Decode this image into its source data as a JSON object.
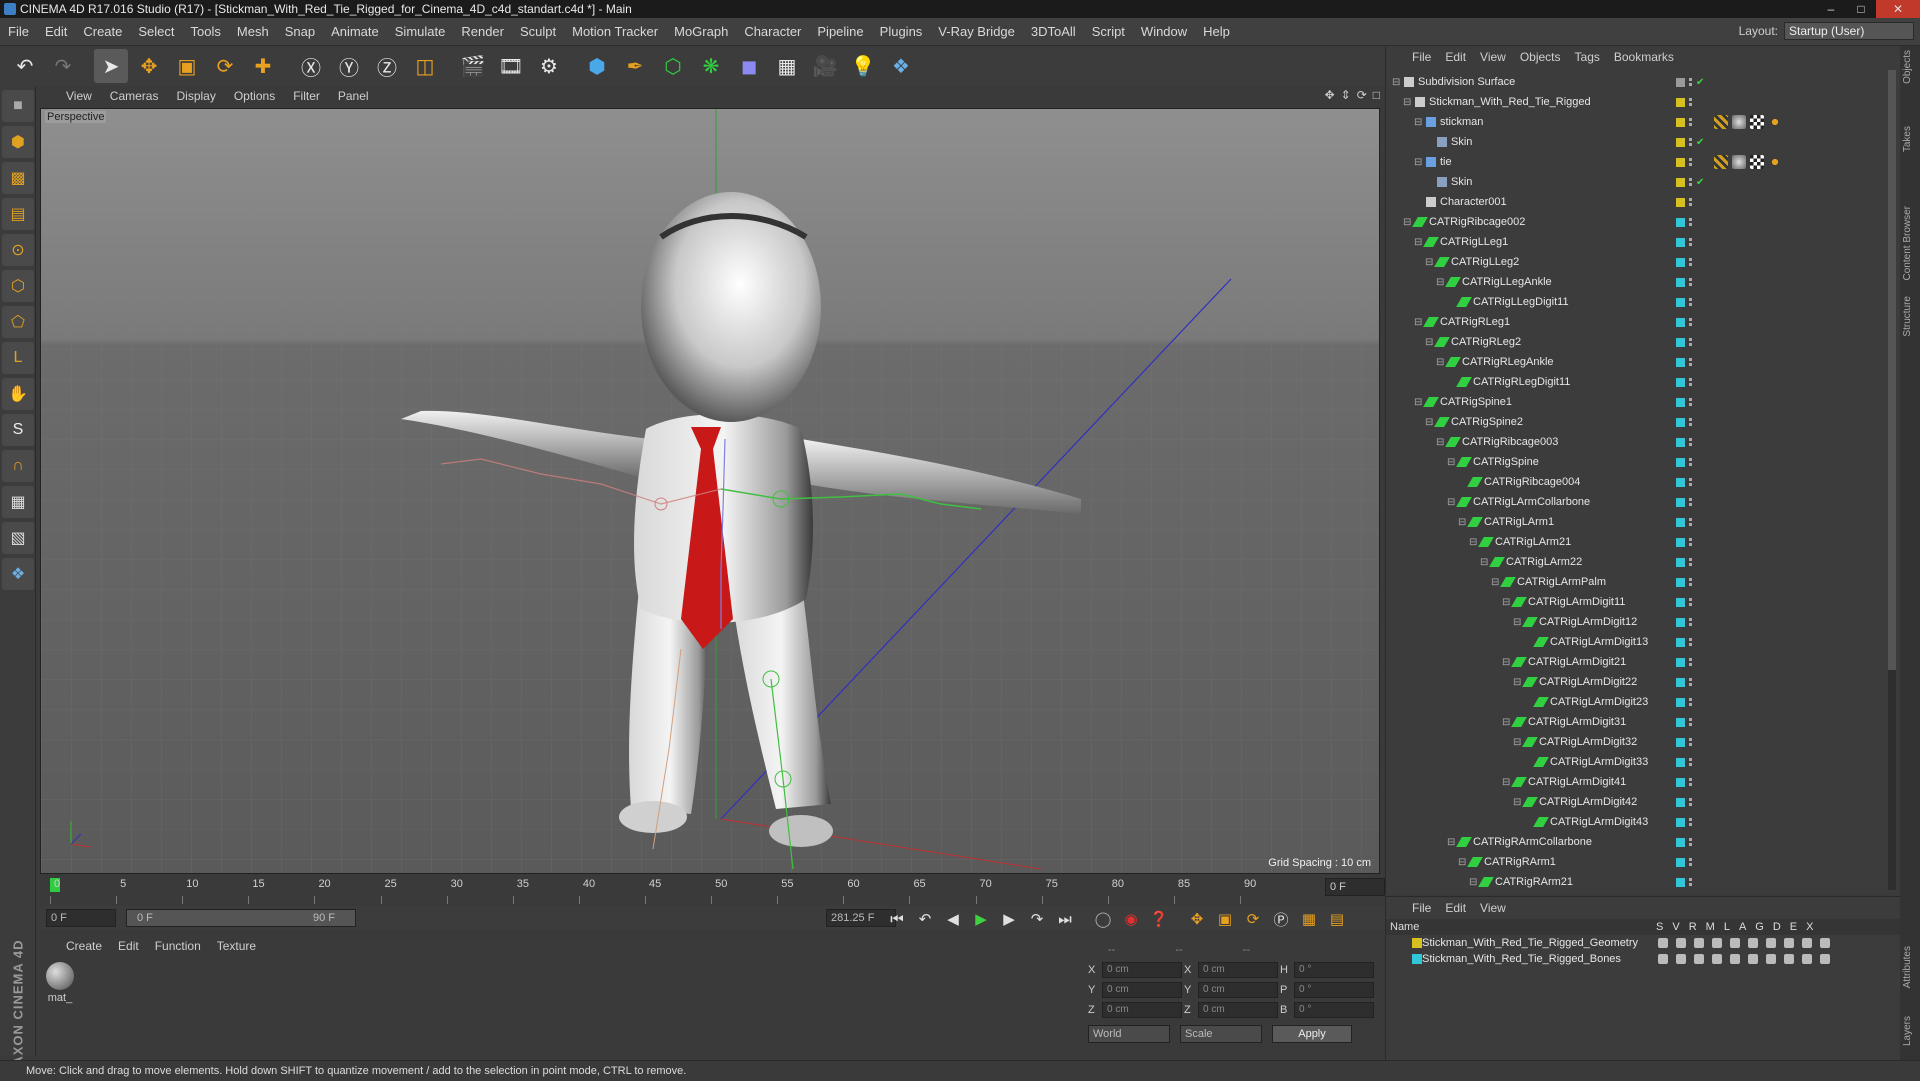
{
  "titlebar": {
    "title": "CINEMA 4D R17.016 Studio (R17) - [Stickman_With_Red_Tie_Rigged_for_Cinema_4D_c4d_standart.c4d *] - Main"
  },
  "menubar": {
    "items": [
      "File",
      "Edit",
      "Create",
      "Select",
      "Tools",
      "Mesh",
      "Snap",
      "Animate",
      "Simulate",
      "Render",
      "Sculpt",
      "Motion Tracker",
      "MoGraph",
      "Character",
      "Pipeline",
      "Plugins",
      "V-Ray Bridge",
      "3DToAll",
      "Script",
      "Window",
      "Help"
    ]
  },
  "layout": {
    "label": "Layout:",
    "value": "Startup (User)"
  },
  "viewport": {
    "menu": [
      "View",
      "Cameras",
      "Display",
      "Options",
      "Filter",
      "Panel"
    ],
    "label": "Perspective",
    "grid_spacing": "Grid Spacing : 10 cm"
  },
  "timeline": {
    "ticks": [
      "0",
      "5",
      "10",
      "15",
      "20",
      "25",
      "30",
      "35",
      "40",
      "45",
      "50",
      "55",
      "60",
      "65",
      "70",
      "75",
      "80",
      "85",
      "90"
    ],
    "frame_end": "0 F",
    "current_frame": 0,
    "max_frame": 90
  },
  "transport": {
    "start_field": "0 F",
    "range_start": "0 F",
    "range_end": "90 F",
    "end_field": "281.25 F"
  },
  "material": {
    "menu": [
      "Create",
      "Edit",
      "Function",
      "Texture"
    ],
    "mat_name": "mat_"
  },
  "coords": {
    "rows": [
      {
        "a": "X",
        "av": "0 cm",
        "b": "X",
        "bv": "0 cm",
        "c": "H",
        "cv": "0 °"
      },
      {
        "a": "Y",
        "av": "0 cm",
        "b": "Y",
        "bv": "0 cm",
        "c": "P",
        "cv": "0 °"
      },
      {
        "a": "Z",
        "av": "0 cm",
        "b": "Z",
        "bv": "0 cm",
        "c": "B",
        "cv": "0 °"
      }
    ],
    "space": "World",
    "mode": "Scale",
    "apply": "Apply",
    "header": [
      "--",
      "--",
      "--"
    ]
  },
  "status": {
    "text": "Move: Click and drag to move elements. Hold down SHIFT to quantize movement / add to the selection in point mode, CTRL to remove."
  },
  "objects": {
    "menu": [
      "File",
      "Edit",
      "View",
      "Objects",
      "Tags",
      "Bookmarks"
    ],
    "colors": {
      "yellow": "#d8c020",
      "cyan": "#30c8d8",
      "green": "#30d040"
    },
    "items": [
      {
        "name": "Subdivision Surface",
        "depth": 0,
        "exp": "⊟",
        "color": "gray",
        "icon": "subdivision-icon",
        "check": true
      },
      {
        "name": "Stickman_With_Red_Tie_Rigged",
        "depth": 1,
        "exp": "⊟",
        "color": "yellow",
        "icon": "null-icon",
        "check": false
      },
      {
        "name": "stickman",
        "depth": 2,
        "exp": "⊟",
        "color": "yellow",
        "icon": "mesh-icon",
        "check": false,
        "tags": true
      },
      {
        "name": "Skin",
        "depth": 3,
        "exp": "",
        "color": "yellow",
        "icon": "skin-icon",
        "check": true
      },
      {
        "name": "tie",
        "depth": 2,
        "exp": "⊟",
        "color": "yellow",
        "icon": "mesh-icon",
        "check": false,
        "tags": true
      },
      {
        "name": "Skin",
        "depth": 3,
        "exp": "",
        "color": "yellow",
        "icon": "skin-icon",
        "check": true
      },
      {
        "name": "Character001",
        "depth": 2,
        "exp": "",
        "color": "yellow",
        "icon": "null-icon",
        "check": false
      },
      {
        "name": "CATRigRibcage002",
        "depth": 1,
        "exp": "⊟",
        "color": "cyan",
        "icon": "joint-icon",
        "check": false
      },
      {
        "name": "CATRigLLeg1",
        "depth": 2,
        "exp": "⊟",
        "color": "cyan",
        "icon": "joint-icon",
        "check": false
      },
      {
        "name": "CATRigLLeg2",
        "depth": 3,
        "exp": "⊟",
        "color": "cyan",
        "icon": "joint-icon",
        "check": false
      },
      {
        "name": "CATRigLLegAnkle",
        "depth": 4,
        "exp": "⊟",
        "color": "cyan",
        "icon": "joint-icon",
        "check": false
      },
      {
        "name": "CATRigLLegDigit11",
        "depth": 5,
        "exp": "",
        "color": "cyan",
        "icon": "joint-icon",
        "check": false
      },
      {
        "name": "CATRigRLeg1",
        "depth": 2,
        "exp": "⊟",
        "color": "cyan",
        "icon": "joint-icon",
        "check": false
      },
      {
        "name": "CATRigRLeg2",
        "depth": 3,
        "exp": "⊟",
        "color": "cyan",
        "icon": "joint-icon",
        "check": false
      },
      {
        "name": "CATRigRLegAnkle",
        "depth": 4,
        "exp": "⊟",
        "color": "cyan",
        "icon": "joint-icon",
        "check": false
      },
      {
        "name": "CATRigRLegDigit11",
        "depth": 5,
        "exp": "",
        "color": "cyan",
        "icon": "joint-icon",
        "check": false
      },
      {
        "name": "CATRigSpine1",
        "depth": 2,
        "exp": "⊟",
        "color": "cyan",
        "icon": "joint-icon",
        "check": false
      },
      {
        "name": "CATRigSpine2",
        "depth": 3,
        "exp": "⊟",
        "color": "cyan",
        "icon": "joint-icon",
        "check": false
      },
      {
        "name": "CATRigRibcage003",
        "depth": 4,
        "exp": "⊟",
        "color": "cyan",
        "icon": "joint-icon",
        "check": false
      },
      {
        "name": "CATRigSpine",
        "depth": 5,
        "exp": "⊟",
        "color": "cyan",
        "icon": "joint-icon",
        "check": false
      },
      {
        "name": "CATRigRibcage004",
        "depth": 6,
        "exp": "",
        "color": "cyan",
        "icon": "joint-icon",
        "check": false
      },
      {
        "name": "CATRigLArmCollarbone",
        "depth": 5,
        "exp": "⊟",
        "color": "cyan",
        "icon": "joint-icon",
        "check": false
      },
      {
        "name": "CATRigLArm1",
        "depth": 6,
        "exp": "⊟",
        "color": "cyan",
        "icon": "joint-icon",
        "check": false
      },
      {
        "name": "CATRigLArm21",
        "depth": 7,
        "exp": "⊟",
        "color": "cyan",
        "icon": "joint-icon",
        "check": false
      },
      {
        "name": "CATRigLArm22",
        "depth": 8,
        "exp": "⊟",
        "color": "cyan",
        "icon": "joint-icon",
        "check": false
      },
      {
        "name": "CATRigLArmPalm",
        "depth": 9,
        "exp": "⊟",
        "color": "cyan",
        "icon": "joint-icon",
        "check": false
      },
      {
        "name": "CATRigLArmDigit11",
        "depth": 10,
        "exp": "⊟",
        "color": "cyan",
        "icon": "joint-icon",
        "check": false
      },
      {
        "name": "CATRigLArmDigit12",
        "depth": 11,
        "exp": "⊟",
        "color": "cyan",
        "icon": "joint-icon",
        "check": false
      },
      {
        "name": "CATRigLArmDigit13",
        "depth": 12,
        "exp": "",
        "color": "cyan",
        "icon": "joint-icon",
        "check": false
      },
      {
        "name": "CATRigLArmDigit21",
        "depth": 10,
        "exp": "⊟",
        "color": "cyan",
        "icon": "joint-icon",
        "check": false
      },
      {
        "name": "CATRigLArmDigit22",
        "depth": 11,
        "exp": "⊟",
        "color": "cyan",
        "icon": "joint-icon",
        "check": false
      },
      {
        "name": "CATRigLArmDigit23",
        "depth": 12,
        "exp": "",
        "color": "cyan",
        "icon": "joint-icon",
        "check": false
      },
      {
        "name": "CATRigLArmDigit31",
        "depth": 10,
        "exp": "⊟",
        "color": "cyan",
        "icon": "joint-icon",
        "check": false
      },
      {
        "name": "CATRigLArmDigit32",
        "depth": 11,
        "exp": "⊟",
        "color": "cyan",
        "icon": "joint-icon",
        "check": false
      },
      {
        "name": "CATRigLArmDigit33",
        "depth": 12,
        "exp": "",
        "color": "cyan",
        "icon": "joint-icon",
        "check": false
      },
      {
        "name": "CATRigLArmDigit41",
        "depth": 10,
        "exp": "⊟",
        "color": "cyan",
        "icon": "joint-icon",
        "check": false
      },
      {
        "name": "CATRigLArmDigit42",
        "depth": 11,
        "exp": "⊟",
        "color": "cyan",
        "icon": "joint-icon",
        "check": false
      },
      {
        "name": "CATRigLArmDigit43",
        "depth": 12,
        "exp": "",
        "color": "cyan",
        "icon": "joint-icon",
        "check": false
      },
      {
        "name": "CATRigRArmCollarbone",
        "depth": 5,
        "exp": "⊟",
        "color": "cyan",
        "icon": "joint-icon",
        "check": false
      },
      {
        "name": "CATRigRArm1",
        "depth": 6,
        "exp": "⊟",
        "color": "cyan",
        "icon": "joint-icon",
        "check": false
      },
      {
        "name": "CATRigRArm21",
        "depth": 7,
        "exp": "⊟",
        "color": "cyan",
        "icon": "joint-icon",
        "check": false
      }
    ]
  },
  "layers": {
    "menu": [
      "File",
      "Edit",
      "View"
    ],
    "header": {
      "name": "Name",
      "cols": [
        "S",
        "V",
        "R",
        "M",
        "L",
        "A",
        "G",
        "D",
        "E",
        "X"
      ]
    },
    "items": [
      {
        "name": "Stickman_With_Red_Tie_Rigged_Geometry",
        "color": "#d8c020"
      },
      {
        "name": "Stickman_With_Red_Tie_Rigged_Bones",
        "color": "#30c8d8"
      }
    ]
  },
  "right_tabs": [
    "Objects",
    "Takes",
    "Content Browser",
    "Structure",
    "Attributes",
    "Layers"
  ]
}
